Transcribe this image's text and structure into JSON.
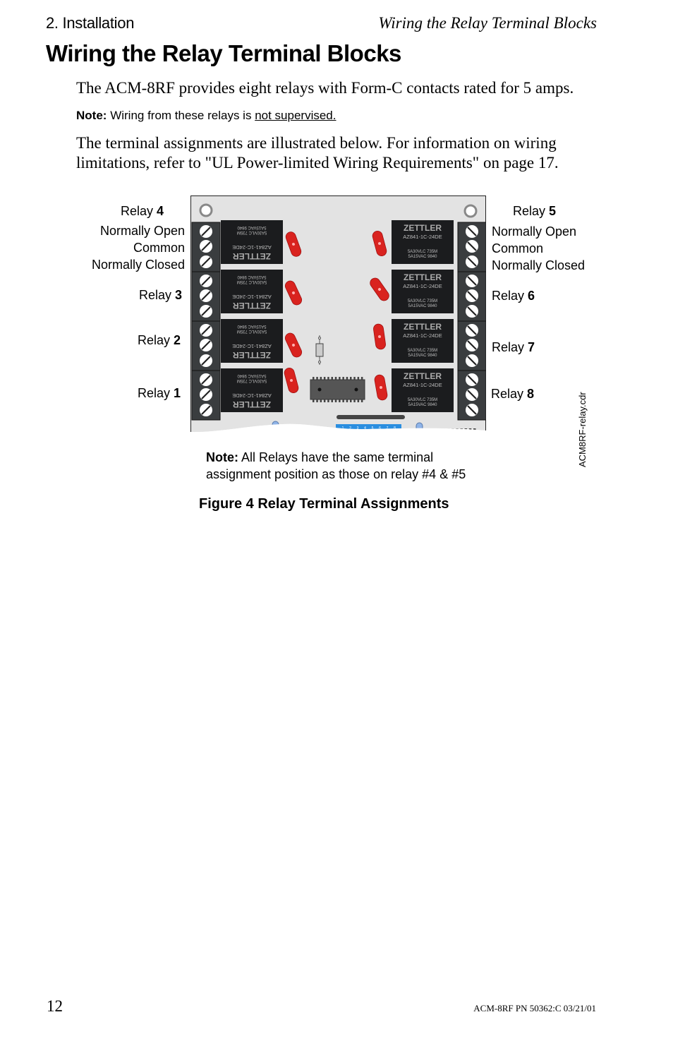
{
  "header": {
    "section": "2. Installation",
    "running_title": "Wiring the Relay Terminal Blocks"
  },
  "title": "Wiring the Relay Terminal Blocks",
  "body": {
    "paragraph1": "The ACM-8RF provides eight relays with Form-C contacts rated for 5 amps.",
    "note": {
      "label": "Note:",
      "text": "Wiring from these relays is ",
      "underlined": "not supervised."
    },
    "paragraph2": "The terminal assignments are illustrated below.  For information on wiring limitations, refer to \"UL Power-limited Wiring Requirements\" on page 17."
  },
  "figure": {
    "left_relays": [
      {
        "prefix": "Relay ",
        "number": "4"
      },
      {
        "prefix": "Relay ",
        "number": "3"
      },
      {
        "prefix": "Relay ",
        "number": "2"
      },
      {
        "prefix": "Relay ",
        "number": "1"
      }
    ],
    "right_relays": [
      {
        "prefix": "Relay ",
        "number": "5"
      },
      {
        "prefix": "Relay ",
        "number": "6"
      },
      {
        "prefix": "Relay ",
        "number": "7"
      },
      {
        "prefix": "Relay ",
        "number": "8"
      }
    ],
    "terminals": [
      "Normally Open",
      "Common",
      "Normally Closed"
    ],
    "relay_component": {
      "brand": "ZETTLER",
      "model": "AZ841-1C-24DE",
      "rating1": "5A30VLC  735M",
      "rating2": "5A15VAC  9840"
    },
    "dip_switch_numbers": [
      "1",
      "2",
      "3",
      "4",
      "5",
      "6",
      "7",
      "8"
    ],
    "note": {
      "label": "Note:",
      "line1": " All Relays have the same terminal",
      "line2": "assignment position as those on relay #4 & #5"
    },
    "file_label": "ACM8RF-relay.cdr",
    "caption": "Figure 4  Relay Terminal Assignments",
    "colors": {
      "board": "#e3e3e3",
      "terminal_block": "#3a3d3f",
      "relay_body": "#1b1c1e",
      "led_red": "#d9231f",
      "led_blue": "#8fb4e8",
      "dip_blue": "#2a8ee0"
    }
  },
  "footer": {
    "page_number": "12",
    "doc_id": "ACM-8RF  PN 50362:C  03/21/01"
  }
}
